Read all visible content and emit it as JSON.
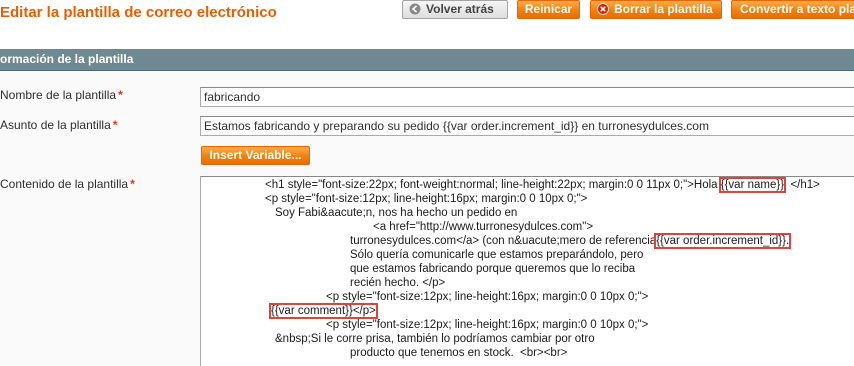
{
  "header": {
    "title": "Editar la plantilla de correo electrónico",
    "buttons": {
      "back": "Volver atrás",
      "reset": "Reinicar",
      "delete": "Borrar la plantilla",
      "convert": "Convertir a texto pla"
    }
  },
  "section": {
    "title": "ormación de la plantilla"
  },
  "form": {
    "name": {
      "label": "Nombre de la plantilla",
      "required": "*",
      "value": "fabricando"
    },
    "subject": {
      "label": "Asunto de la plantilla",
      "required": "*",
      "value": "Estamos fabricando y preparando su pedido {{var order.increment_id}} en turronesydulces.com"
    },
    "insert_variable": "Insert Variable...",
    "content": {
      "label": "Contenido de la plantilla",
      "required": "*",
      "lines": [
        {
          "a": "<h1 style=\"font-size:22px; font-weight:normal; line-height:22px; margin:0 0 11px 0;\">Hola ",
          "hl": "{{var name}}",
          "b": "  </h1>"
        },
        {
          "a": "<p style=\"font-size:12px; line-height:16px; margin:0 0 10px 0;\">"
        },
        {
          "a": "Soy Fabi&aacute;n, nos ha hecho un pedido en"
        },
        {
          "a": "<a href=\"http://www.turronesydulces.com\">"
        },
        {
          "a": "turronesydulces.com</a> (con n&uacute;mero de referencia",
          "hl": "{{var order.increment_id}}."
        },
        {
          "a": "Sólo quería comunicarle que estamos preparándolo, pero"
        },
        {
          "a": "que estamos fabricando porque queremos que lo reciba"
        },
        {
          "a": "recién hecho. </p>"
        },
        {
          "a": "<p style=\"font-size:12px; line-height:16px; margin:0 0 10px 0;\">"
        },
        {
          "hl": "{{var comment}}</p>"
        },
        {
          "a": "<p style=\"font-size:12px; line-height:16px; margin:0 0 10px 0;\">"
        },
        {
          "a": "&nbsp;Si le corre prisa, también lo podríamos cambiar por otro"
        },
        {
          "a": "producto que tenemos en stock.  <br><br>"
        }
      ]
    }
  },
  "colors": {
    "accent": "#eb5e00",
    "section_bar": "#6f8992",
    "highlight": "#e3413a"
  }
}
